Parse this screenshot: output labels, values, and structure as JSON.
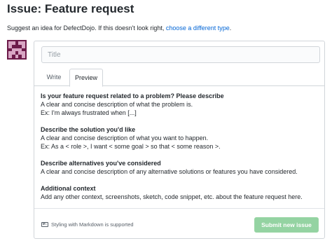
{
  "header": {
    "title": "Issue: Feature request",
    "subtitle_prefix": "Suggest an idea for DefectDojo. If this doesn't look right, ",
    "subtitle_link": "choose a different type",
    "subtitle_suffix": "."
  },
  "form": {
    "title_placeholder": "Title",
    "title_value": "",
    "tabs": [
      {
        "label": "Write",
        "active": false
      },
      {
        "label": "Preview",
        "active": true
      }
    ],
    "preview_sections": [
      {
        "heading": "Is your feature request related to a problem? Please describe",
        "lines": [
          "A clear and concise description of what the problem is.",
          "Ex: I'm always frustrated when [...]"
        ]
      },
      {
        "heading": "Describe the solution you'd like",
        "lines": [
          "A clear and concise description of what you want to happen.",
          "Ex: As a < role >, I want < some goal > so that < some reason >."
        ]
      },
      {
        "heading": "Describe alternatives you've considered",
        "lines": [
          "A clear and concise description of any alternative solutions or features you have considered."
        ]
      },
      {
        "heading": "Additional context",
        "lines": [
          "Add any other context, screenshots, sketch, code snippet, etc. about the feature request here."
        ]
      }
    ],
    "markdown_note": "Styling with Markdown is supported",
    "submit_label": "Submit new issue"
  },
  "colors": {
    "link": "#0366d6",
    "avatar_bg": "#6d1b4a",
    "avatar_fg": "#d8a6c4",
    "submit_disabled": "#94d3a2"
  }
}
